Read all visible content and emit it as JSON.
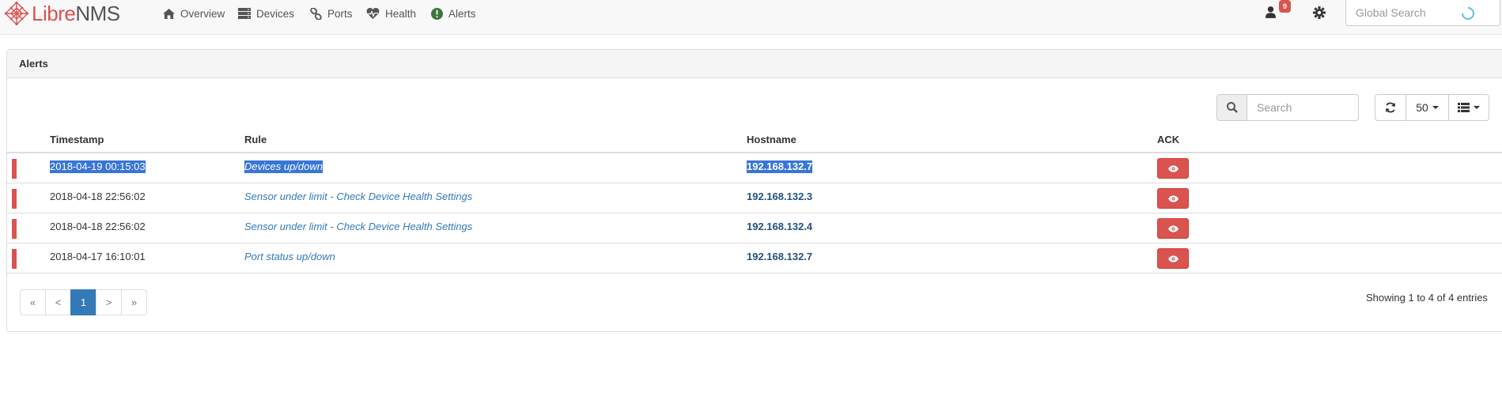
{
  "brand": {
    "part1": "Libre",
    "part2": "NMS"
  },
  "nav": [
    {
      "label": "Overview",
      "icon": "home-icon"
    },
    {
      "label": "Devices",
      "icon": "server-icon"
    },
    {
      "label": "Ports",
      "icon": "link-icon"
    },
    {
      "label": "Health",
      "icon": "heartbeat-icon"
    },
    {
      "label": "Alerts",
      "icon": "exclamation-circle-icon"
    }
  ],
  "user": {
    "notification_count": "9"
  },
  "global_search": {
    "placeholder": "Global Search"
  },
  "panel": {
    "title": "Alerts"
  },
  "toolbar": {
    "search_placeholder": "Search",
    "page_size": "50"
  },
  "table": {
    "columns": [
      "Timestamp",
      "Rule",
      "Hostname",
      "ACK"
    ],
    "rows": [
      {
        "timestamp": "2018-04-19 00:15:03",
        "rule": "Devices up/down",
        "hostname": "192.168.132.7",
        "severity": "critical",
        "selected": true
      },
      {
        "timestamp": "2018-04-18 22:56:02",
        "rule": "Sensor under limit - Check Device Health Settings",
        "hostname": "192.168.132.3",
        "severity": "critical"
      },
      {
        "timestamp": "2018-04-18 22:56:02",
        "rule": "Sensor under limit - Check Device Health Settings",
        "hostname": "192.168.132.4",
        "severity": "critical"
      },
      {
        "timestamp": "2018-04-17 16:10:01",
        "rule": "Port status up/down",
        "hostname": "192.168.132.7",
        "severity": "critical"
      }
    ]
  },
  "pagination": {
    "first": "«",
    "prev": "<",
    "current": "1",
    "next": ">",
    "last": "»",
    "info": "Showing 1 to 4 of 4 entries"
  },
  "colors": {
    "accent": "#337ab7",
    "danger": "#d9534f",
    "navbar_bg": "#f8f8f8",
    "panel_heading_bg": "#f5f5f5",
    "alert_health_icon": "#3c763d"
  }
}
